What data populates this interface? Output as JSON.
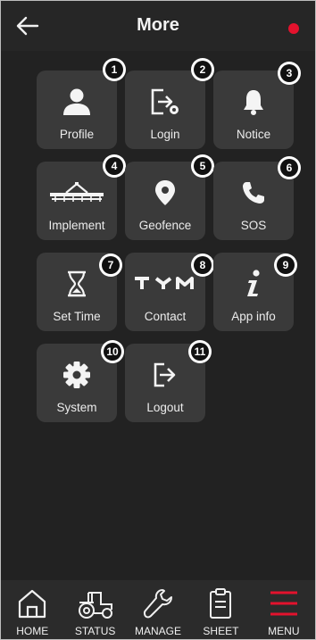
{
  "header": {
    "title": "More",
    "back_icon": "arrow-left-icon",
    "status_dot_color": "#e3122d"
  },
  "menu": {
    "items": [
      {
        "label": "Profile",
        "badge": "1",
        "icon": "person-icon"
      },
      {
        "label": "Login",
        "badge": "2",
        "icon": "login-gear-icon"
      },
      {
        "label": "Notice",
        "badge": "3",
        "icon": "bell-icon"
      },
      {
        "label": "Implement",
        "badge": "4",
        "icon": "implement-icon"
      },
      {
        "label": "Geofence",
        "badge": "5",
        "icon": "location-pin-icon"
      },
      {
        "label": "SOS",
        "badge": "6",
        "icon": "phone-icon"
      },
      {
        "label": "Set Time",
        "badge": "7",
        "icon": "hourglass-icon"
      },
      {
        "label": "Contact",
        "badge": "8",
        "icon": "tym-logo"
      },
      {
        "label": "App info",
        "badge": "9",
        "icon": "info-icon"
      },
      {
        "label": "System",
        "badge": "10",
        "icon": "gear-icon"
      },
      {
        "label": "Logout",
        "badge": "11",
        "icon": "logout-icon"
      }
    ],
    "contact_logo_text": "TYM"
  },
  "bottom_nav": {
    "items": [
      {
        "label": "HOME",
        "icon": "home-icon"
      },
      {
        "label": "STATUS",
        "icon": "tractor-icon"
      },
      {
        "label": "MANAGE",
        "icon": "wrench-icon"
      },
      {
        "label": "SHEET",
        "icon": "clipboard-icon"
      },
      {
        "label": "MENU",
        "icon": "hamburger-icon",
        "active": true
      }
    ],
    "active_color": "#e3122d"
  }
}
